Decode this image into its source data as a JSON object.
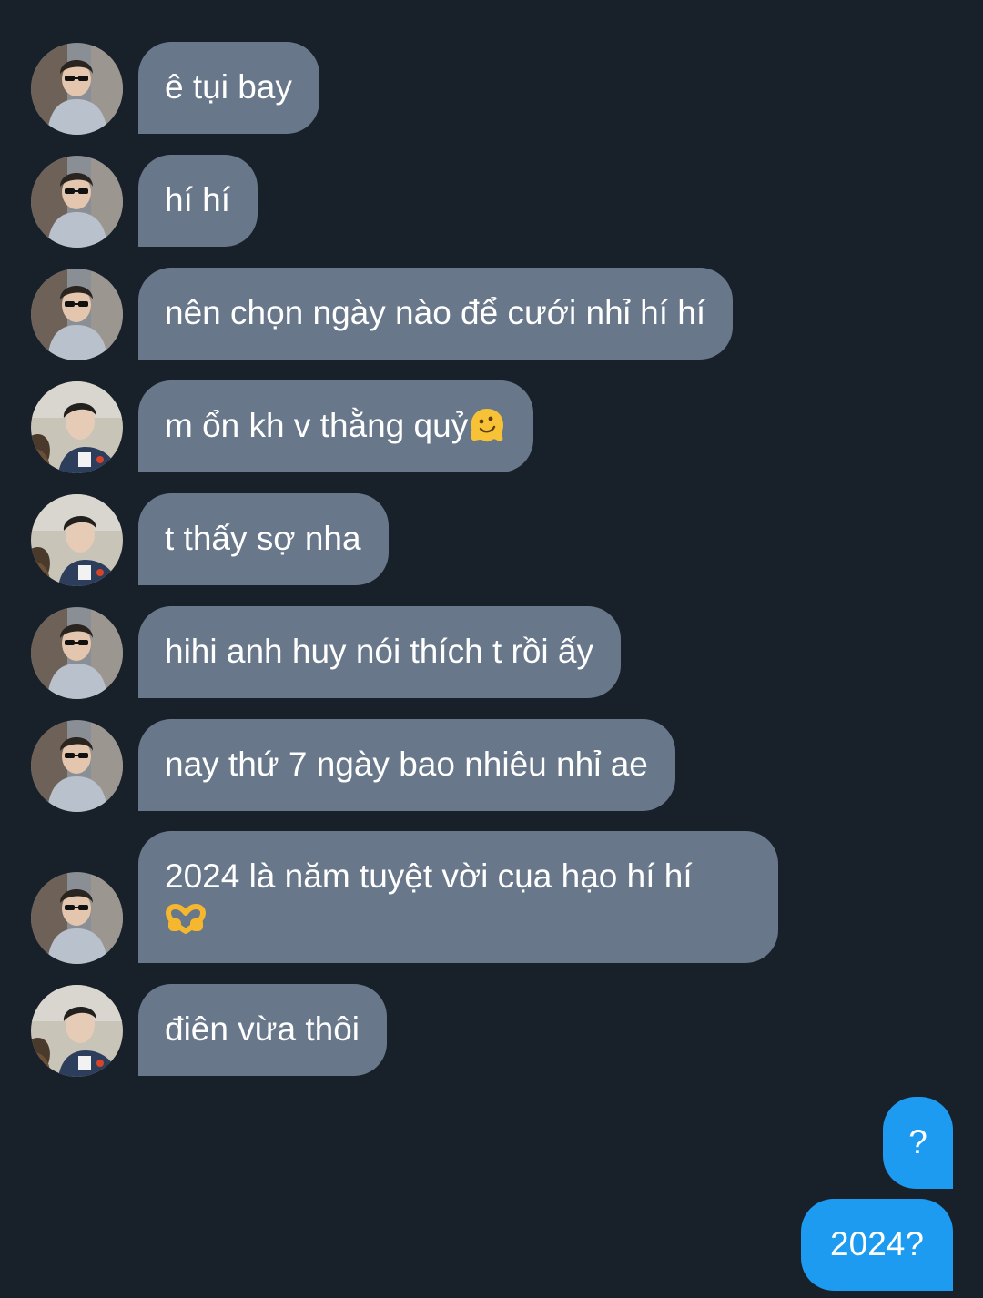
{
  "messages": [
    {
      "sender": "friend-a",
      "text": "ê tụi bay"
    },
    {
      "sender": "friend-a",
      "text": "hí hí"
    },
    {
      "sender": "friend-a",
      "text": "nên chọn ngày nào để cưới nhỉ hí hí"
    },
    {
      "sender": "friend-b",
      "text": "m ổn kh v thằng quỷ",
      "emoji": "melting-face-emoji"
    },
    {
      "sender": "friend-b",
      "text": "t thấy sợ nha"
    },
    {
      "sender": "friend-a",
      "text": "hihi anh huy nói thích t rồi ấy"
    },
    {
      "sender": "friend-a",
      "text": "nay thứ 7 ngày bao nhiêu nhỉ ae"
    },
    {
      "sender": "friend-a",
      "text": "2024 là năm tuyệt vời cụa hạo hí hí",
      "emoji": "heart-hands-emoji"
    },
    {
      "sender": "friend-b",
      "text": "điên vừa thôi"
    }
  ],
  "outgoing": [
    {
      "text": "?"
    },
    {
      "text": "2024?"
    }
  ],
  "colors": {
    "background": "#18202a",
    "incoming_bubble": "#68778a",
    "outgoing_bubble": "#1d9bf0"
  }
}
